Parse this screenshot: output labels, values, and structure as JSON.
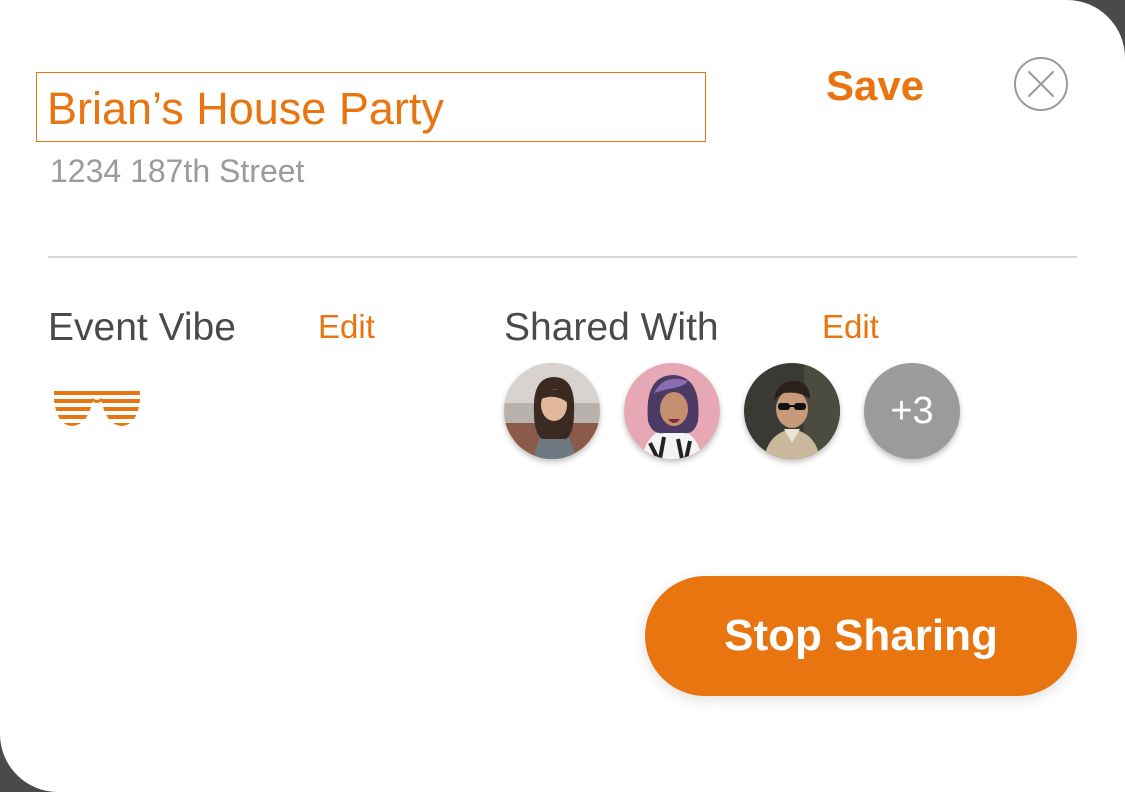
{
  "event": {
    "title": "Brian’s House Party",
    "address": "1234 187th Street"
  },
  "header": {
    "save_label": "Save",
    "close_icon": "close-circle-icon"
  },
  "vibe": {
    "label": "Event Vibe",
    "edit_label": "Edit",
    "icon": "shutter-shades-icon"
  },
  "shared": {
    "label": "Shared With",
    "edit_label": "Edit",
    "more_count": "+3"
  },
  "actions": {
    "stop_label": "Stop Sharing"
  },
  "colors": {
    "accent": "#e8750f",
    "muted": "#9b9b9b",
    "text": "#4a4a4a",
    "divider": "#d7d7e0"
  }
}
